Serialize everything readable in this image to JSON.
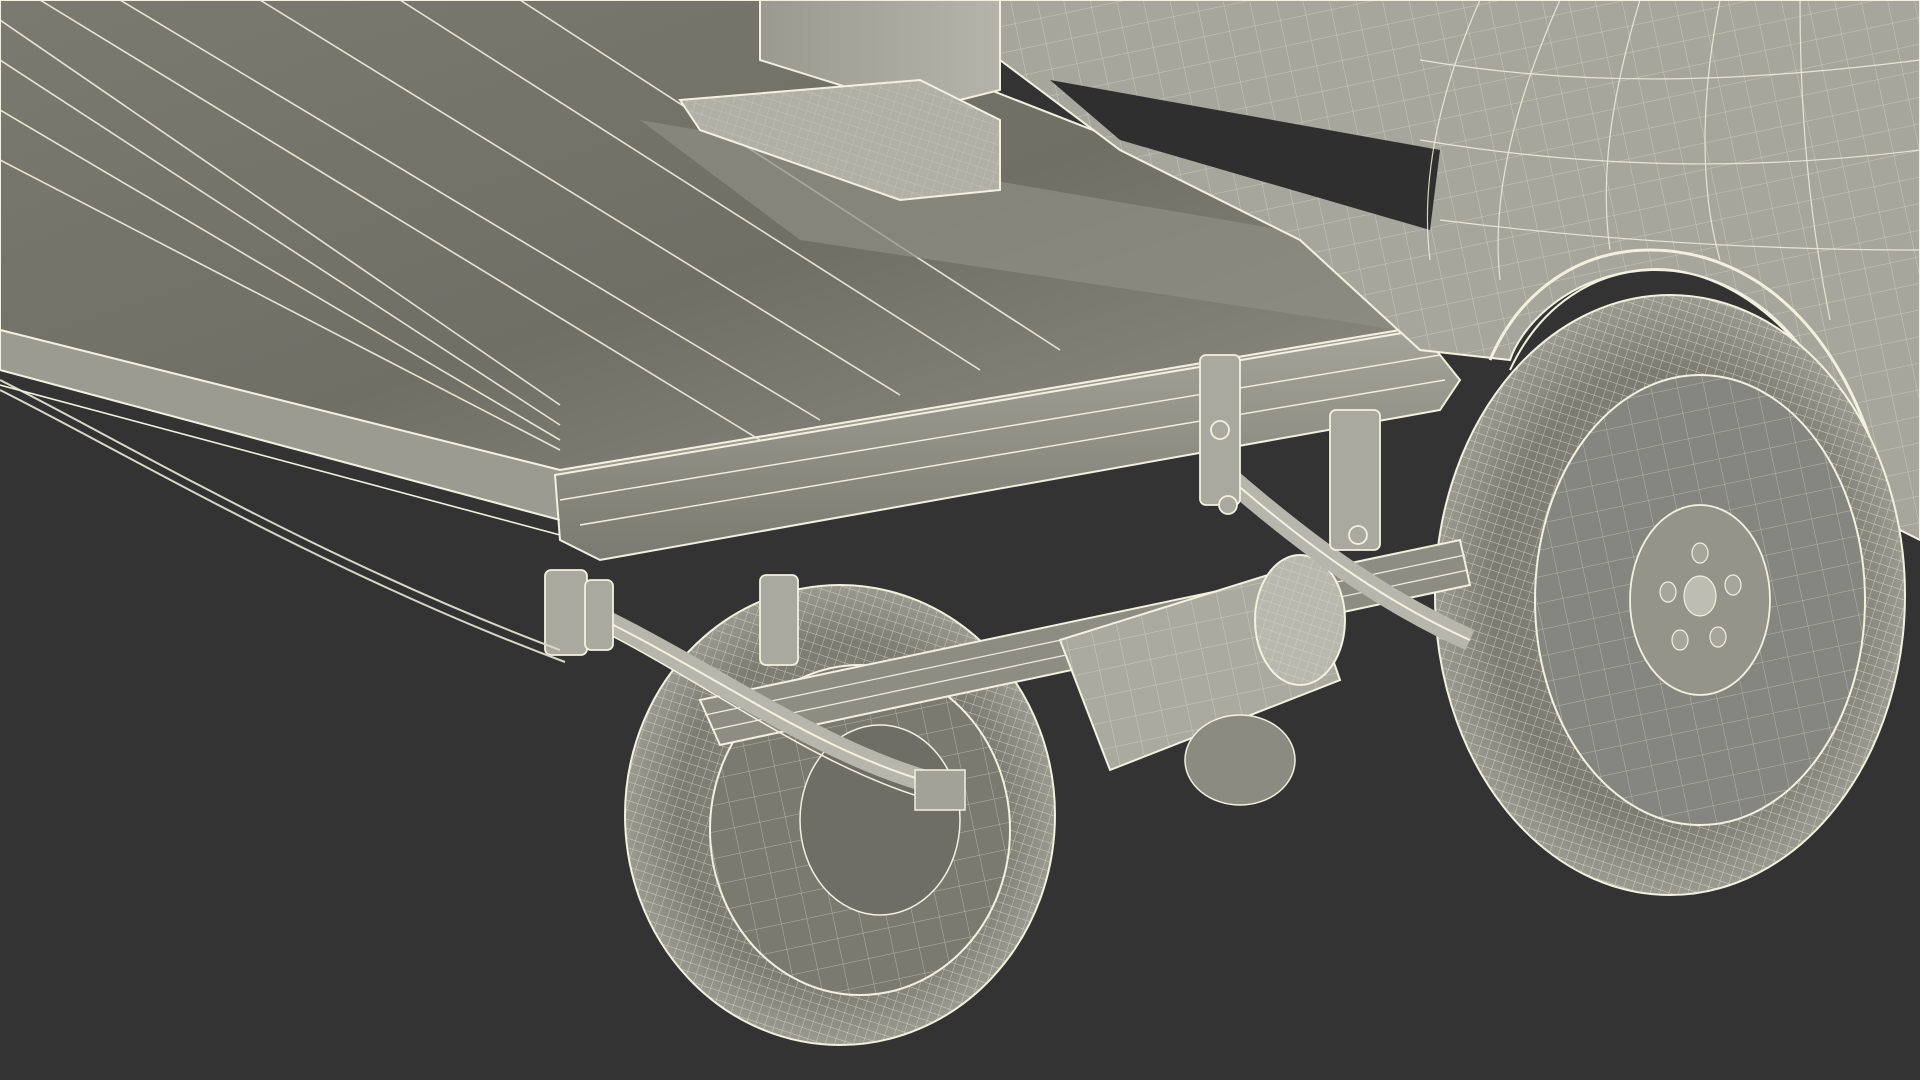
{
  "scene": {
    "background_color": "#333333",
    "panel_color": "#8c8c82",
    "panel_light_color": "#a9a99f",
    "panel_dark_color": "#5e5e56",
    "wire_color": "#f2f1df",
    "tire_color": "#7d7d74",
    "subject": "pickup-truck-underside-wireframe"
  }
}
